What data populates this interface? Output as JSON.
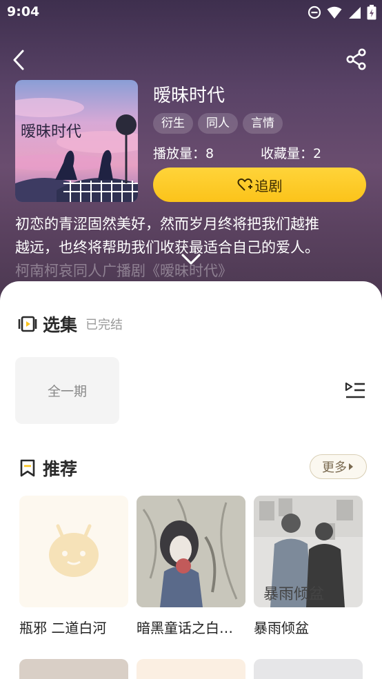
{
  "status_bar": {
    "time": "9:04"
  },
  "drama": {
    "title": "暧昧时代",
    "tags": [
      "衍生",
      "同人",
      "言情"
    ],
    "play_count_label": "播放量：8",
    "fav_count_label": "收藏量：2",
    "follow_label": "追剧",
    "cover_title": "暧昧时代",
    "description_lines": [
      "初恋的青涩固然美好，然而岁月终将把我们越推",
      "越远，也终将帮助我们收获最适合自己的爱人。",
      "柯南柯哀同人广播剧《暧昧时代》"
    ]
  },
  "episodes": {
    "title": "选集",
    "status": "已完结",
    "items": [
      "全一期"
    ]
  },
  "recommend": {
    "title": "推荐",
    "more_label": "更多",
    "items": [
      {
        "name": "瓶邪 二道白河"
      },
      {
        "name": "暗黑童话之白…"
      },
      {
        "name": "暴雨倾盆",
        "cover_text": "暴雨倾盆"
      }
    ]
  },
  "colors": {
    "accent": "#fbc31a",
    "hero_bg": "#5a4367"
  }
}
